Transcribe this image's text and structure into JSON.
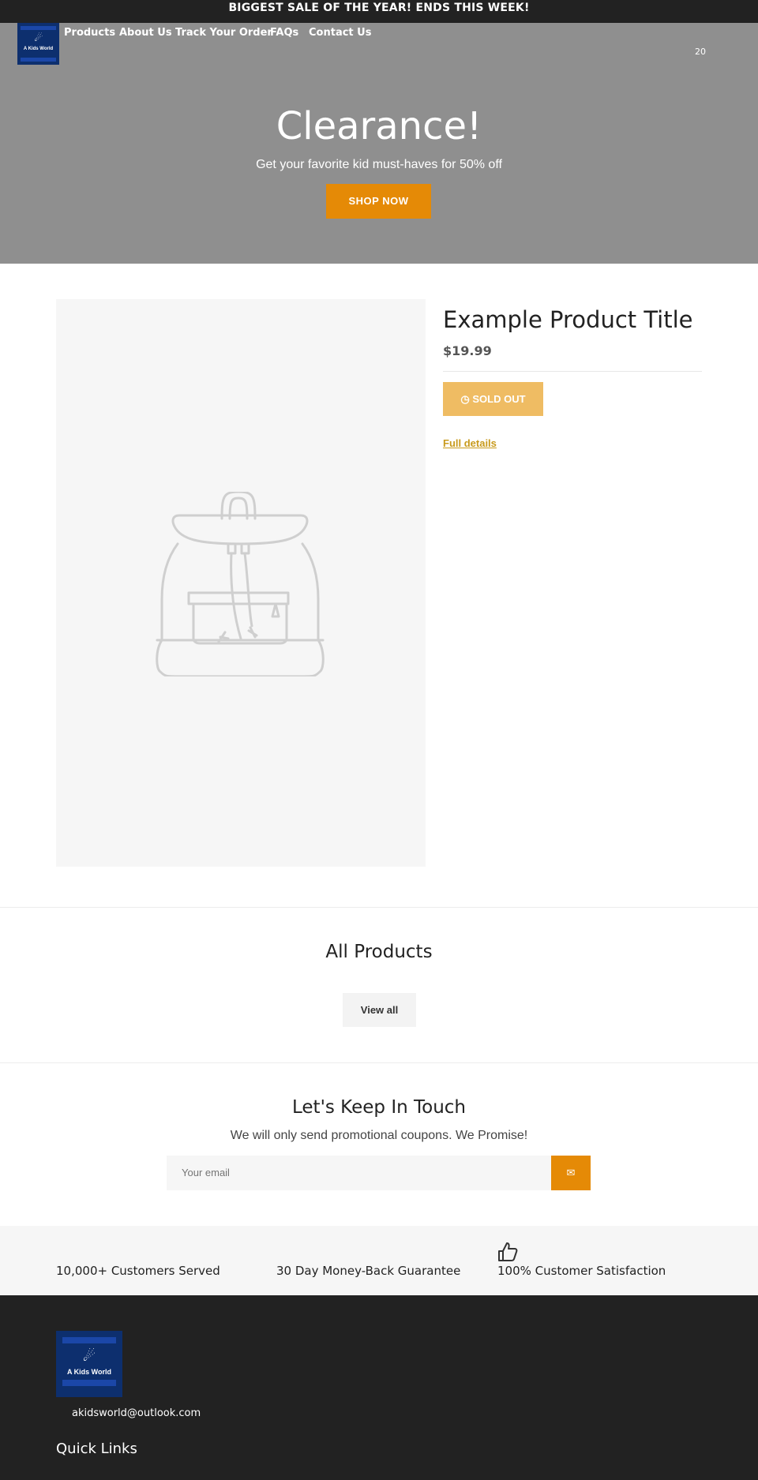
{
  "announcement": "BIGGEST SALE OF THE YEAR! ENDS THIS WEEK!",
  "brand": {
    "name": "A Kids World"
  },
  "nav": {
    "items": [
      "Products",
      "About Us",
      "Track Your Order",
      "FAQs",
      "Contact Us"
    ]
  },
  "cart": {
    "icon": "cart-icon",
    "label": "20"
  },
  "hero": {
    "title": "Clearance!",
    "subtitle": "Get your favorite kid must-haves for 50% off",
    "button": "SHOP NOW"
  },
  "product": {
    "title": "Example Product Title",
    "price": "$19.99",
    "sold_out": "SOLD OUT",
    "full_details": "Full details",
    "image_icon": "backpack-placeholder"
  },
  "collection": {
    "title": "All Products",
    "button": "View all"
  },
  "newsletter": {
    "title": "Let's Keep In Touch",
    "subtitle": "We will only send promotional coupons. We Promise!",
    "placeholder": "Your email",
    "submit_icon": "envelope-icon"
  },
  "trust": {
    "items": [
      "10,000+ Customers Served",
      "30 Day Money-Back Guarantee",
      "100% Customer Satisfaction"
    ],
    "icon": "thumbs-up-icon"
  },
  "footer": {
    "email": "akidsworld@outlook.com",
    "quick_links_title": "Quick Links"
  },
  "colors": {
    "accent": "#e58a06",
    "sold_out": "#efbc63",
    "link": "#c89a1c",
    "dark": "#222222",
    "hero_bg": "#8f8f8f",
    "logo_bg": "#0d2f6e"
  }
}
